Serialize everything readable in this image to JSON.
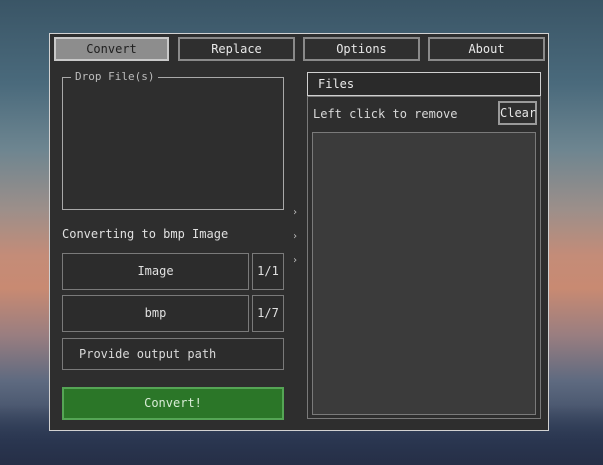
{
  "tabs": [
    {
      "label": "Convert",
      "active": true
    },
    {
      "label": "Replace",
      "active": false
    },
    {
      "label": "Options",
      "active": false
    },
    {
      "label": "About",
      "active": false
    }
  ],
  "convert": {
    "drop_label": "Drop File(s)",
    "status": "Converting to bmp Image",
    "type_value": "Image",
    "type_counter": "1/1",
    "format_value": "bmp",
    "format_counter": "1/7",
    "output_path_placeholder": "Provide output path",
    "convert_button": "Convert!"
  },
  "files": {
    "header": "Files",
    "hint": "Left click to remove",
    "clear_button": "Clear"
  },
  "colors": {
    "convert_button_bg": "#2b7628",
    "convert_button_border": "#55a555",
    "panel_bg": "#2e2e2e"
  }
}
